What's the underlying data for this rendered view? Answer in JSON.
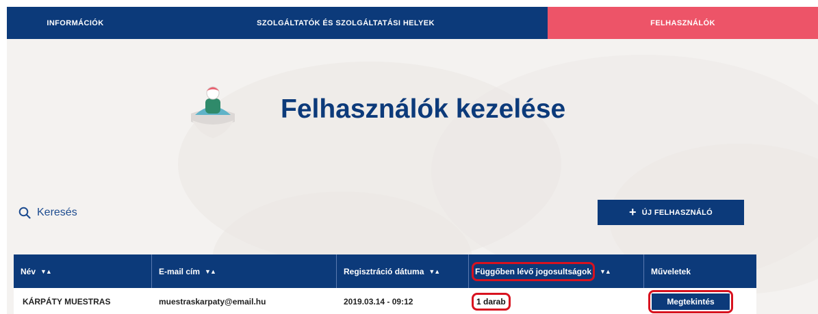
{
  "nav": {
    "tabs": [
      {
        "label": "INFORMÁCIÓK"
      },
      {
        "label": "SZOLGÁLTATÓK ÉS SZOLGÁLTATÁSI HELYEK"
      },
      {
        "label": "FELHASZNÁLÓK"
      }
    ],
    "active_index": 2
  },
  "hero": {
    "title": "Felhasználók kezelése",
    "mascot_icon": "user-mascot-icon"
  },
  "search": {
    "label": "Keresés",
    "icon": "search-icon"
  },
  "actions": {
    "new_user_label": "ÚJ FELHASZNÁLÓ",
    "new_user_icon": "plus-icon"
  },
  "table": {
    "columns": [
      {
        "label": "Név",
        "sortable": true
      },
      {
        "label": "E-mail cím",
        "sortable": true
      },
      {
        "label": "Regisztráció dátuma",
        "sortable": true
      },
      {
        "label": "Függőben lévő jogosultságok",
        "sortable": true
      },
      {
        "label": "Műveletek",
        "sortable": false
      }
    ],
    "sort_icon": "▼▲",
    "rows": [
      {
        "name": "KÁRPÁTY MUESTRAS",
        "email": "muestraskarpaty@email.hu",
        "registered": "2019.03.14 - 09:12",
        "pending": "1 darab",
        "action": "Megtekintés"
      }
    ]
  },
  "colors": {
    "primary": "#0c3a7a",
    "accent": "#ed5468",
    "highlight": "#d8121f",
    "background": "#f4f2f0"
  }
}
